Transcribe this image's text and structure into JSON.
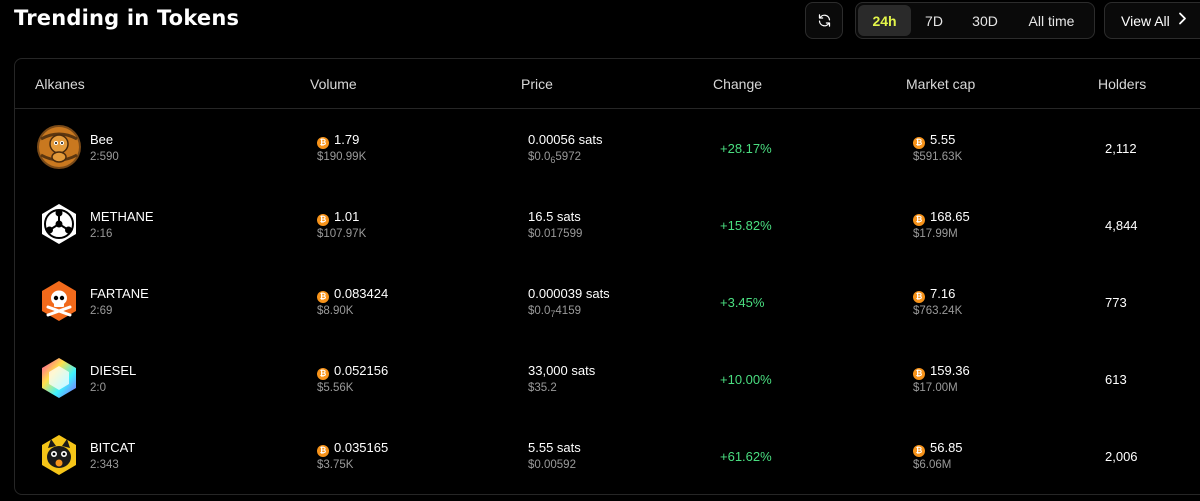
{
  "header": {
    "title": "Trending in Tokens",
    "refresh_icon": "refresh-icon",
    "ranges": [
      "24h",
      "7D",
      "30D",
      "All time"
    ],
    "active_range": "24h",
    "view_all_label": "View All",
    "view_all_icon": "chevron-right-icon"
  },
  "colors": {
    "accent_active_tab": "#e3f54a",
    "positive_change": "#4ade80",
    "btc_orange": "#f7931a",
    "background": "#000000"
  },
  "table": {
    "columns": [
      "Alkanes",
      "Volume",
      "Price",
      "Change",
      "Market cap",
      "Holders"
    ],
    "rows": [
      {
        "name": "Bee",
        "id": "2:590",
        "logo_icon": "bee-token-icon",
        "volume_btc": "1.79",
        "volume_usd": "$190.99K",
        "price_sats": "0.00056 sats",
        "price_usd_prefix": "$0.0",
        "price_usd_sub": "6",
        "price_usd_rest": "5972",
        "change": "+28.17%",
        "mcap_btc": "5.55",
        "mcap_usd": "$591.63K",
        "holders": "2,112"
      },
      {
        "name": "METHANE",
        "id": "2:16",
        "logo_icon": "methane-token-icon",
        "volume_btc": "1.01",
        "volume_usd": "$107.97K",
        "price_sats": "16.5 sats",
        "price_usd_prefix": "$0.017599",
        "price_usd_sub": "",
        "price_usd_rest": "",
        "change": "+15.82%",
        "mcap_btc": "168.65",
        "mcap_usd": "$17.99M",
        "holders": "4,844"
      },
      {
        "name": "FARTANE",
        "id": "2:69",
        "logo_icon": "skull-token-icon",
        "volume_btc": "0.083424",
        "volume_usd": "$8.90K",
        "price_sats": "0.000039 sats",
        "price_usd_prefix": "$0.0",
        "price_usd_sub": "7",
        "price_usd_rest": "4159",
        "change": "+3.45%",
        "mcap_btc": "7.16",
        "mcap_usd": "$763.24K",
        "holders": "773"
      },
      {
        "name": "DIESEL",
        "id": "2:0",
        "logo_icon": "diesel-token-icon",
        "volume_btc": "0.052156",
        "volume_usd": "$5.56K",
        "price_sats": "33,000 sats",
        "price_usd_prefix": "$35.2",
        "price_usd_sub": "",
        "price_usd_rest": "",
        "change": "+10.00%",
        "mcap_btc": "159.36",
        "mcap_usd": "$17.00M",
        "holders": "613"
      },
      {
        "name": "BITCAT",
        "id": "2:343",
        "logo_icon": "cat-token-icon",
        "volume_btc": "0.035165",
        "volume_usd": "$3.75K",
        "price_sats": "5.55 sats",
        "price_usd_prefix": "$0.00592",
        "price_usd_sub": "",
        "price_usd_rest": "",
        "change": "+61.62%",
        "mcap_btc": "56.85",
        "mcap_usd": "$6.06M",
        "holders": "2,006"
      }
    ]
  }
}
